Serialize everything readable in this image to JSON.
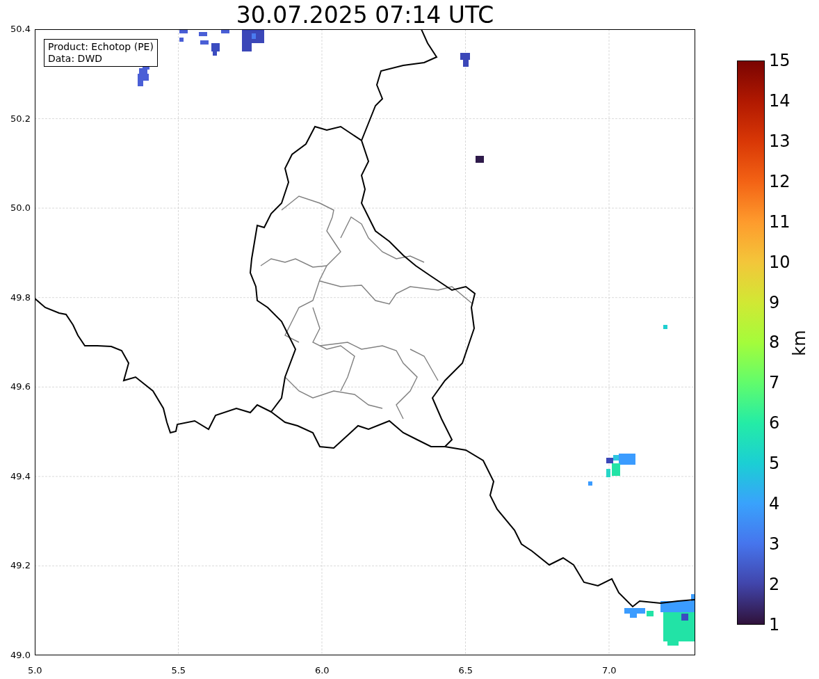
{
  "title": "30.07.2025 07:14 UTC",
  "legend": [
    "Product: Echotop (PE)",
    "Data: DWD"
  ],
  "x_ticks": [
    "5.0",
    "5.5",
    "6.0",
    "6.5",
    "7.0"
  ],
  "y_ticks": [
    "50.4",
    "50.2",
    "50.0",
    "49.8",
    "49.6",
    "49.4",
    "49.2",
    "49.0"
  ],
  "colorbar": {
    "label": "km",
    "ticks": [
      "15",
      "14",
      "13",
      "12",
      "11",
      "10",
      "9",
      "8",
      "7",
      "6",
      "5",
      "4",
      "3",
      "2",
      "1"
    ]
  }
}
